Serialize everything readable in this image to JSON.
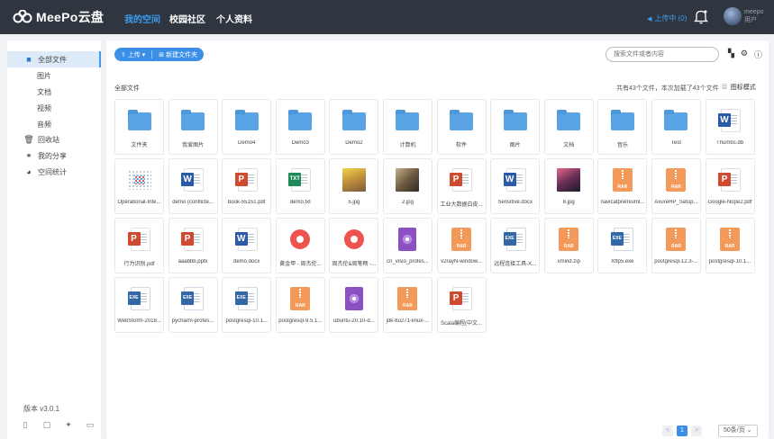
{
  "app": {
    "name": "MeePo云盘"
  },
  "nav": {
    "items": [
      "我的空间",
      "校园社区",
      "个人资料"
    ]
  },
  "header": {
    "upload_status": "上传中 (0)",
    "user_name": "meepo",
    "user_sub": "用户"
  },
  "sidebar": {
    "items": [
      {
        "label": "全部文件",
        "icon": "folder-icon"
      },
      {
        "label": "图片"
      },
      {
        "label": "文档"
      },
      {
        "label": "视频"
      },
      {
        "label": "音频"
      },
      {
        "label": "回收站",
        "icon": "trash-icon"
      },
      {
        "label": "我的分享",
        "icon": "share-icon"
      },
      {
        "label": "空间统计",
        "icon": "pie-chart-icon"
      }
    ],
    "version": "版本 v3.0.1",
    "platforms": [
      "phone-icon",
      "tablet-icon",
      "android-icon",
      "desktop-icon",
      "more-icon"
    ]
  },
  "toolbar": {
    "upload_label": "上传",
    "new_folder_label": "新建文件夹",
    "search_placeholder": "搜索文件或者内容"
  },
  "breadcrumb": "全部文件",
  "summary": "共有43个文件，本次加载了43个文件",
  "view_mode": "图标模式",
  "colors": {
    "accent": "#3b8fe8",
    "topbar": "#2f3640"
  },
  "files": [
    {
      "name": "文件夹",
      "type": "folder"
    },
    {
      "name": "我爱图片",
      "type": "folder"
    },
    {
      "name": "Demo4",
      "type": "folder"
    },
    {
      "name": "Demo3",
      "type": "folder"
    },
    {
      "name": "Demo2",
      "type": "folder"
    },
    {
      "name": "计算机",
      "type": "folder"
    },
    {
      "name": "软件",
      "type": "folder"
    },
    {
      "name": "图片",
      "type": "folder"
    },
    {
      "name": "文档",
      "type": "folder"
    },
    {
      "name": "音乐",
      "type": "folder"
    },
    {
      "name": "Test",
      "type": "folder"
    },
    {
      "name": "Thumbs.db",
      "type": "word"
    },
    {
      "name": "Operational-Inte...",
      "type": "dots"
    },
    {
      "name": "demo (conflicte...",
      "type": "word"
    },
    {
      "name": "book-55151.pdf",
      "type": "ppt"
    },
    {
      "name": "demo.txt",
      "type": "txt"
    },
    {
      "name": "5.jpg",
      "type": "img1"
    },
    {
      "name": "2.jpg",
      "type": "img2"
    },
    {
      "name": "工业大数据白皮...",
      "type": "ppt"
    },
    {
      "name": "Sensitive.docx",
      "type": "word"
    },
    {
      "name": "8.jpg",
      "type": "img3"
    },
    {
      "name": "navicatpremiuml...",
      "type": "rar"
    },
    {
      "name": "AxureRP_Setup...",
      "type": "rar"
    },
    {
      "name": "Google-Nope2.pdf",
      "type": "ppt"
    },
    {
      "name": "行为识别.pdf",
      "type": "ppt"
    },
    {
      "name": "aaabbb.pptx",
      "type": "ppt"
    },
    {
      "name": "demo.docx",
      "type": "word"
    },
    {
      "name": "黄金甲 - 周杰伦...",
      "type": "music"
    },
    {
      "name": "周杰伦&周笔畅 -...",
      "type": "music"
    },
    {
      "name": "cn_visio_profes...",
      "type": "iso"
    },
    {
      "name": "v2rayN-window...",
      "type": "rar"
    },
    {
      "name": "远程连接工具-X...",
      "type": "exe"
    },
    {
      "name": "xmind.zip",
      "type": "rar"
    },
    {
      "name": "Xftp5.exe",
      "type": "exe"
    },
    {
      "name": "postgresql-12.3-...",
      "type": "rar"
    },
    {
      "name": "postgresql-10.1...",
      "type": "rar"
    },
    {
      "name": "WebStorm-2018...",
      "type": "exe"
    },
    {
      "name": "pycharm-profes...",
      "type": "exe"
    },
    {
      "name": "postgresql-10.1...",
      "type": "exe"
    },
    {
      "name": "postgresql-9.5.1...",
      "type": "rar"
    },
    {
      "name": "ubuntu-20.10-d...",
      "type": "iso"
    },
    {
      "name": "jdk-8u271-linux-...",
      "type": "rar"
    },
    {
      "name": "Scala编程(中文...",
      "type": "ppt"
    }
  ],
  "pagination": {
    "prev": "<",
    "current": "1",
    "next": ">",
    "page_size": "50条/页"
  }
}
